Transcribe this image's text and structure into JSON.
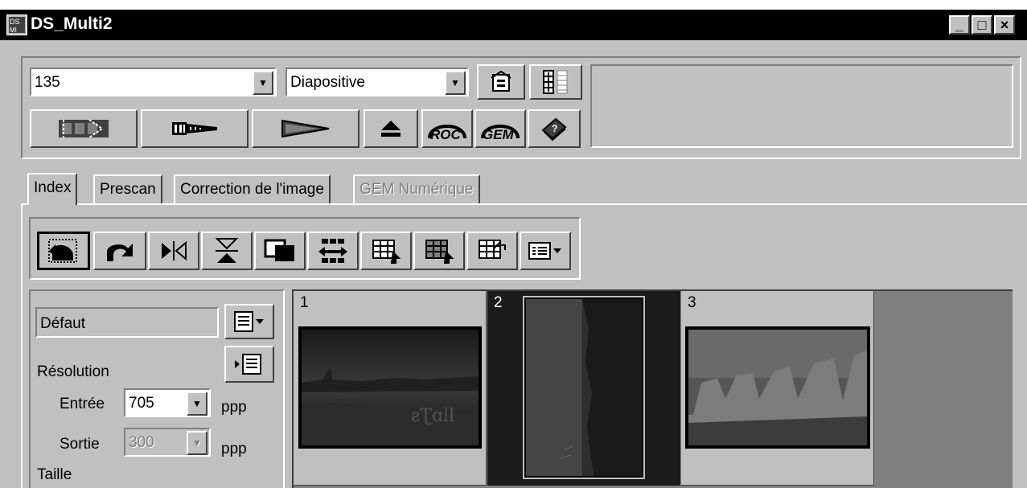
{
  "window": {
    "title": "DS_Multi2",
    "min_label": "_",
    "max_label": "□",
    "close_label": "×"
  },
  "toolbar": {
    "film_format": "135",
    "film_type": "Diapositive",
    "roc_label": "ROC",
    "gem_label": "GEM",
    "info_text": ""
  },
  "tabs": [
    {
      "label": "Index",
      "active": true,
      "enabled": true
    },
    {
      "label": "Prescan",
      "active": false,
      "enabled": true
    },
    {
      "label": "Correction de l'image",
      "active": false,
      "enabled": true
    },
    {
      "label": "GEM Numérique",
      "active": false,
      "enabled": false
    }
  ],
  "settings": {
    "preset": "Défaut",
    "resolution_label": "Résolution",
    "input_label": "Entrée",
    "input_value": "705",
    "input_unit": "ppp",
    "output_label": "Sortie",
    "output_value": "300",
    "output_unit": "ppp",
    "size_label": "Taille"
  },
  "frames": [
    {
      "number": "1",
      "selected": false
    },
    {
      "number": "2",
      "selected": true
    },
    {
      "number": "3",
      "selected": false
    }
  ],
  "colors": {
    "face": "#c0c0c0",
    "titlebar": "#000000",
    "selected_frame": "#1c1c1c",
    "empty_area": "#808080"
  }
}
